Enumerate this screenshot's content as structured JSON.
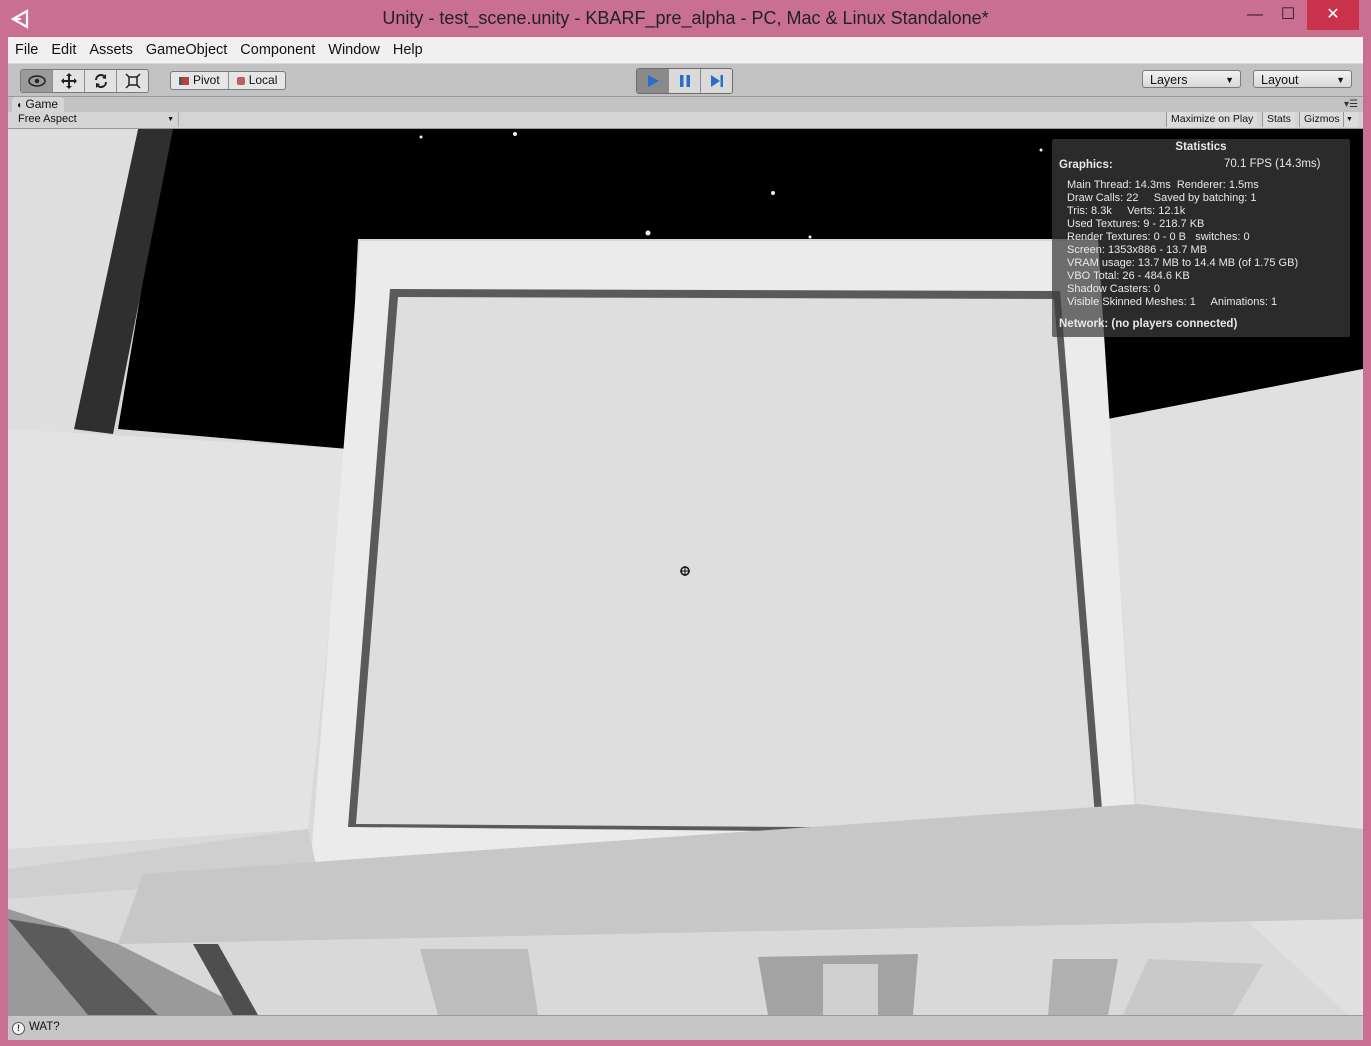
{
  "window": {
    "title": "Unity - test_scene.unity - KBARF_pre_alpha - PC, Mac & Linux Standalone*",
    "controls": {
      "minimize": "—",
      "maximize": "☐",
      "close": "✕"
    }
  },
  "menu": {
    "items": [
      "File",
      "Edit",
      "Assets",
      "GameObject",
      "Component",
      "Window",
      "Help"
    ]
  },
  "toolbar": {
    "tools": [
      "view-eye-icon",
      "move-icon",
      "rotate-icon",
      "scale-icon"
    ],
    "pivot_label": "Pivot",
    "local_label": "Local",
    "layers_label": "Layers",
    "layout_label": "Layout"
  },
  "game_panel": {
    "tab_label": "Game",
    "aspect_label": "Free Aspect",
    "maximize_on_play_label": "Maximize on Play",
    "stats_label": "Stats",
    "gizmos_label": "Gizmos"
  },
  "statistics": {
    "title": "Statistics",
    "graphics_label": "Graphics:",
    "fps": "70.1 FPS (14.3ms)",
    "lines": [
      "Main Thread: 14.3ms  Renderer: 1.5ms",
      "Draw Calls: 22     Saved by batching: 1",
      "Tris: 8.3k     Verts: 12.1k",
      "Used Textures: 9 - 218.7 KB",
      "Render Textures: 0 - 0 B   switches: 0",
      "Screen: 1353x886 - 13.7 MB",
      "VRAM usage: 13.7 MB to 14.4 MB (of 1.75 GB)",
      "VBO Total: 26 - 484.6 KB",
      "Shadow Casters: 0",
      "Visible Skinned Meshes: 1     Animations: 1"
    ],
    "network": "Network: (no players connected)"
  },
  "status": {
    "message": "WAT?"
  },
  "colors": {
    "window_frame": "#c96f92",
    "close_button": "#c8334b",
    "play_active": "#2a6ec8"
  }
}
